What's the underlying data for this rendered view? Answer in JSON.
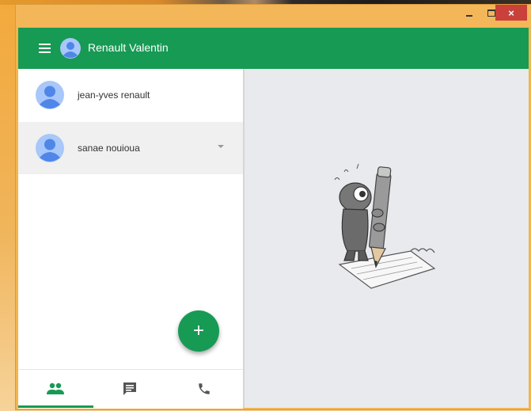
{
  "window": {
    "controls": {
      "minimize": "minimize",
      "maximize": "maximize",
      "close": "×"
    }
  },
  "appbar": {
    "title": "Renault Valentin",
    "menu_icon": "menu-icon",
    "avatar_icon": "avatar-icon"
  },
  "contacts": [
    {
      "name": "jean-yves renault",
      "selected": false
    },
    {
      "name": "sanae nouioua",
      "selected": true
    }
  ],
  "fab": {
    "label": "+"
  },
  "bottom_nav": {
    "items": [
      {
        "icon": "people-icon",
        "active": true
      },
      {
        "icon": "chat-icon",
        "active": false
      },
      {
        "icon": "phone-icon",
        "active": false
      }
    ]
  },
  "colors": {
    "accent": "#179a54",
    "avatar": "#4f86e8",
    "avatar_bg": "#a8c7fa",
    "main_bg": "#e8eaed",
    "titlebar": "#f3b75a",
    "close": "#c9413a"
  }
}
